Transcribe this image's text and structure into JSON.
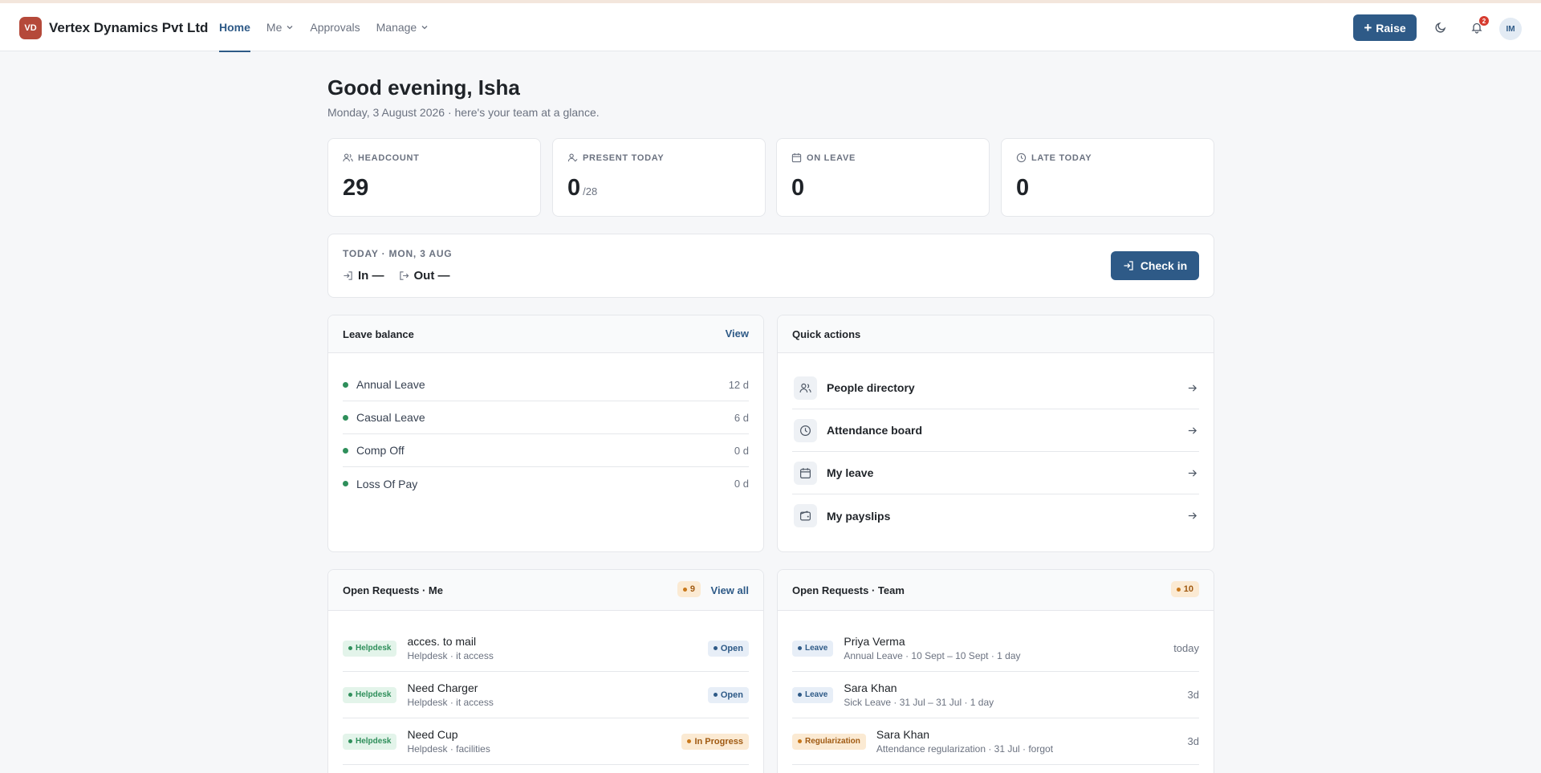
{
  "app": {
    "logo_initials": "VD",
    "company": "Vertex Dynamics Pvt Ltd",
    "nav": [
      {
        "label": "Home",
        "active": true,
        "dropdown": false
      },
      {
        "label": "Me",
        "active": false,
        "dropdown": true
      },
      {
        "label": "Approvals",
        "active": false,
        "dropdown": false
      },
      {
        "label": "Manage",
        "active": false,
        "dropdown": true
      }
    ],
    "raise_label": "Raise",
    "notification_count": "2",
    "user_initials": "IM"
  },
  "header": {
    "greeting": "Good evening, Isha",
    "subline": "Monday, 3 August 2026 · here's your team at a glance."
  },
  "stats": [
    {
      "label": "HEADCOUNT",
      "value": "29",
      "sub": "",
      "icon": "people-icon"
    },
    {
      "label": "PRESENT TODAY",
      "value": "0",
      "sub": "/28",
      "icon": "user-check-icon"
    },
    {
      "label": "ON LEAVE",
      "value": "0",
      "sub": "",
      "icon": "calendar-icon"
    },
    {
      "label": "LATE TODAY",
      "value": "0",
      "sub": "",
      "icon": "clock-icon"
    }
  ],
  "today": {
    "label": "TODAY · MON, 3 AUG",
    "in_label": "In —",
    "out_label": "Out —",
    "checkin_label": "Check in"
  },
  "leave_balance": {
    "title": "Leave balance",
    "link": "View",
    "items": [
      {
        "name": "Annual Leave",
        "value": "12 d"
      },
      {
        "name": "Casual Leave",
        "value": "6 d"
      },
      {
        "name": "Comp Off",
        "value": "0 d"
      },
      {
        "name": "Loss Of Pay",
        "value": "0 d"
      }
    ]
  },
  "quick_actions": {
    "title": "Quick actions",
    "items": [
      {
        "label": "People directory",
        "icon": "people-icon"
      },
      {
        "label": "Attendance board",
        "icon": "clock-icon"
      },
      {
        "label": "My leave",
        "icon": "calendar-icon"
      },
      {
        "label": "My payslips",
        "icon": "wallet-icon"
      }
    ]
  },
  "requests_me": {
    "title": "Open Requests · Me",
    "count": "9",
    "link": "View all",
    "items": [
      {
        "tag": "Helpdesk",
        "title": "acces. to mail",
        "sub": "Helpdesk · it access",
        "status": "Open"
      },
      {
        "tag": "Helpdesk",
        "title": "Need Charger",
        "sub": "Helpdesk · it access",
        "status": "Open"
      },
      {
        "tag": "Helpdesk",
        "title": "Need Cup",
        "sub": "Helpdesk · facilities",
        "status": "In Progress"
      }
    ]
  },
  "requests_team": {
    "title": "Open Requests · Team",
    "count": "10",
    "items": [
      {
        "tag": "Leave",
        "title": "Priya Verma",
        "sub": "Annual Leave · 10 Sept – 10 Sept · 1 day",
        "time": "today"
      },
      {
        "tag": "Leave",
        "title": "Sara Khan",
        "sub": "Sick Leave · 31 Jul – 31 Jul · 1 day",
        "time": "3d"
      },
      {
        "tag": "Regularization",
        "title": "Sara Khan",
        "sub": "Attendance regularization · 31 Jul · forgot",
        "time": "3d"
      }
    ]
  },
  "colors": {
    "accent": "#2e5a87",
    "logo": "#b5493a",
    "success": "#2f8f5b",
    "warning": "#c9781b",
    "badge": "#d63b2f"
  }
}
